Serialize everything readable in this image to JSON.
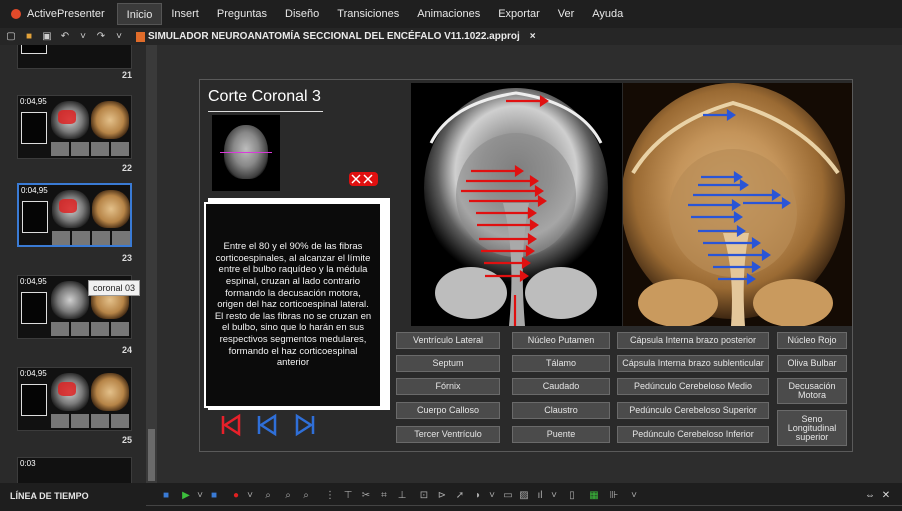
{
  "app": {
    "name": "ActivePresenter"
  },
  "menu": [
    "Inicio",
    "Insert",
    "Preguntas",
    "Diseño",
    "Transiciones",
    "Animaciones",
    "Exportar",
    "Ver",
    "Ayuda"
  ],
  "document_tab": {
    "title": "SIMULADOR NEUROANATOMÍA SECCIONAL DEL ENCÉFALO V11.1022.approj",
    "close": "×"
  },
  "slides": [
    {
      "number": "21",
      "time": ""
    },
    {
      "number": "22",
      "time": "0:04,95"
    },
    {
      "number": "23",
      "time": "0:04,95"
    },
    {
      "number": "24",
      "time": "0:04,95"
    },
    {
      "number": "25",
      "time": "0:04,95"
    },
    {
      "number": "",
      "time": "0:03"
    }
  ],
  "thumb_tooltip": "coronal 03",
  "slide": {
    "title": "Corte Coronal 3",
    "body": "Entre el 80 y el 90% de las fibras corticoespinales, al alcanzar el límite entre el bulbo raquídeo y la médula espinal, cruzan al lado contrario formando la decusación motora, origen del haz corticoespinal lateral.\nEl resto de las fibras no se cruzan en el bulbo, sino que lo harán en sus respectivos segmentos medulares, formando el haz corticoespinal anterior",
    "labels": {
      "col1": [
        "Ventrículo Lateral",
        "Septum",
        "Fórnix",
        "Cuerpo Calloso",
        "Tercer Ventrículo"
      ],
      "col2": [
        "Núcleo Putamen",
        "Tálamo",
        "Caudado",
        "Claustro",
        "Puente"
      ],
      "col3": [
        "Cápsula Interna brazo posterior",
        "Cápsula Interna brazo sublenticular",
        "Pedúnculo Cerebeloso Medio",
        "Pedúnculo Cerebeloso Superior",
        "Pedúnculo Cerebeloso Inferior"
      ],
      "col4": [
        "Núcleo Rojo",
        "Oliva Bulbar",
        "Decusación Motora",
        "Seno Longitudinal superior"
      ]
    }
  },
  "timeline": {
    "label": "LÍNEA DE TIEMPO"
  },
  "colors": {
    "accent": "#3a7bd5",
    "red_arrow": "#e01010",
    "blue_arrow": "#2a55d6",
    "nav_red": "#e8202a",
    "nav_blue": "#2f6fd8"
  }
}
